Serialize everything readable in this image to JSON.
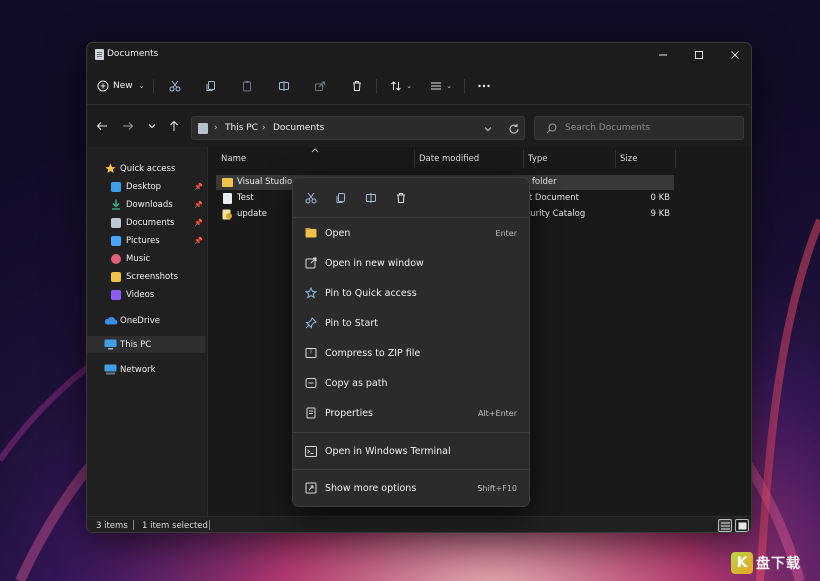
{
  "colors": {
    "window_bg": "#202020",
    "titlebar_bg": "#1c1c1c",
    "content_bg": "#191919",
    "menu_bg": "#2b2b2b",
    "text": "#efefef",
    "muted_text": "#8c8c8c",
    "folder_yellow": "#f1c24a",
    "accent_blue": "#4aa3ff",
    "wallpaper_glow": "#e0457a"
  },
  "window": {
    "title": "Documents",
    "controls": {
      "minimize_icon": "minimize-icon",
      "maximize_icon": "maximize-icon",
      "close_icon": "close-icon"
    }
  },
  "toolbar": {
    "new_label": "New",
    "buttons": [
      "cut-icon",
      "copy-icon",
      "paste-icon",
      "rename-icon",
      "share-icon",
      "delete-icon",
      "sort-icon",
      "view-icon",
      "more-icon"
    ]
  },
  "address": {
    "crumbs": [
      "This PC",
      "Documents"
    ],
    "search_placeholder": "Search Documents"
  },
  "sidebar": {
    "quick_access": "Quick access",
    "items": [
      {
        "label": "Desktop",
        "pinned": true
      },
      {
        "label": "Downloads",
        "pinned": true
      },
      {
        "label": "Documents",
        "pinned": true
      },
      {
        "label": "Pictures",
        "pinned": true
      },
      {
        "label": "Music",
        "pinned": false
      },
      {
        "label": "Screenshots",
        "pinned": false
      },
      {
        "label": "Videos",
        "pinned": false
      }
    ],
    "onedrive": "OneDrive",
    "this_pc": "This PC",
    "network": "Network"
  },
  "columns": {
    "name": "Name",
    "date": "Date modified",
    "type": "Type",
    "size": "Size"
  },
  "files": [
    {
      "name": "Visual Studio 2019",
      "type": "File folder",
      "size": ""
    },
    {
      "name": "Test",
      "type": "Text Document",
      "size": "0 KB"
    },
    {
      "name": "update",
      "type": "Security Catalog",
      "size": "9 KB"
    }
  ],
  "context_menu": {
    "quick_actions": [
      "cut-icon",
      "copy-icon",
      "rename-icon",
      "delete-icon"
    ],
    "items": [
      {
        "label": "Open",
        "shortcut": "Enter"
      },
      {
        "label": "Open in new window",
        "shortcut": ""
      },
      {
        "label": "Pin to Quick access",
        "shortcut": ""
      },
      {
        "label": "Pin to Start",
        "shortcut": ""
      },
      {
        "label": "Compress to ZIP file",
        "shortcut": ""
      },
      {
        "label": "Copy as path",
        "shortcut": ""
      },
      {
        "label": "Properties",
        "shortcut": "Alt+Enter"
      },
      {
        "label": "Open in Windows Terminal",
        "shortcut": ""
      },
      {
        "label": "Show more options",
        "shortcut": "Shift+F10"
      }
    ]
  },
  "status": {
    "item_count": "3 items",
    "selection": "1 item selected"
  },
  "watermark": {
    "badge": "K",
    "text": "盘下载"
  }
}
